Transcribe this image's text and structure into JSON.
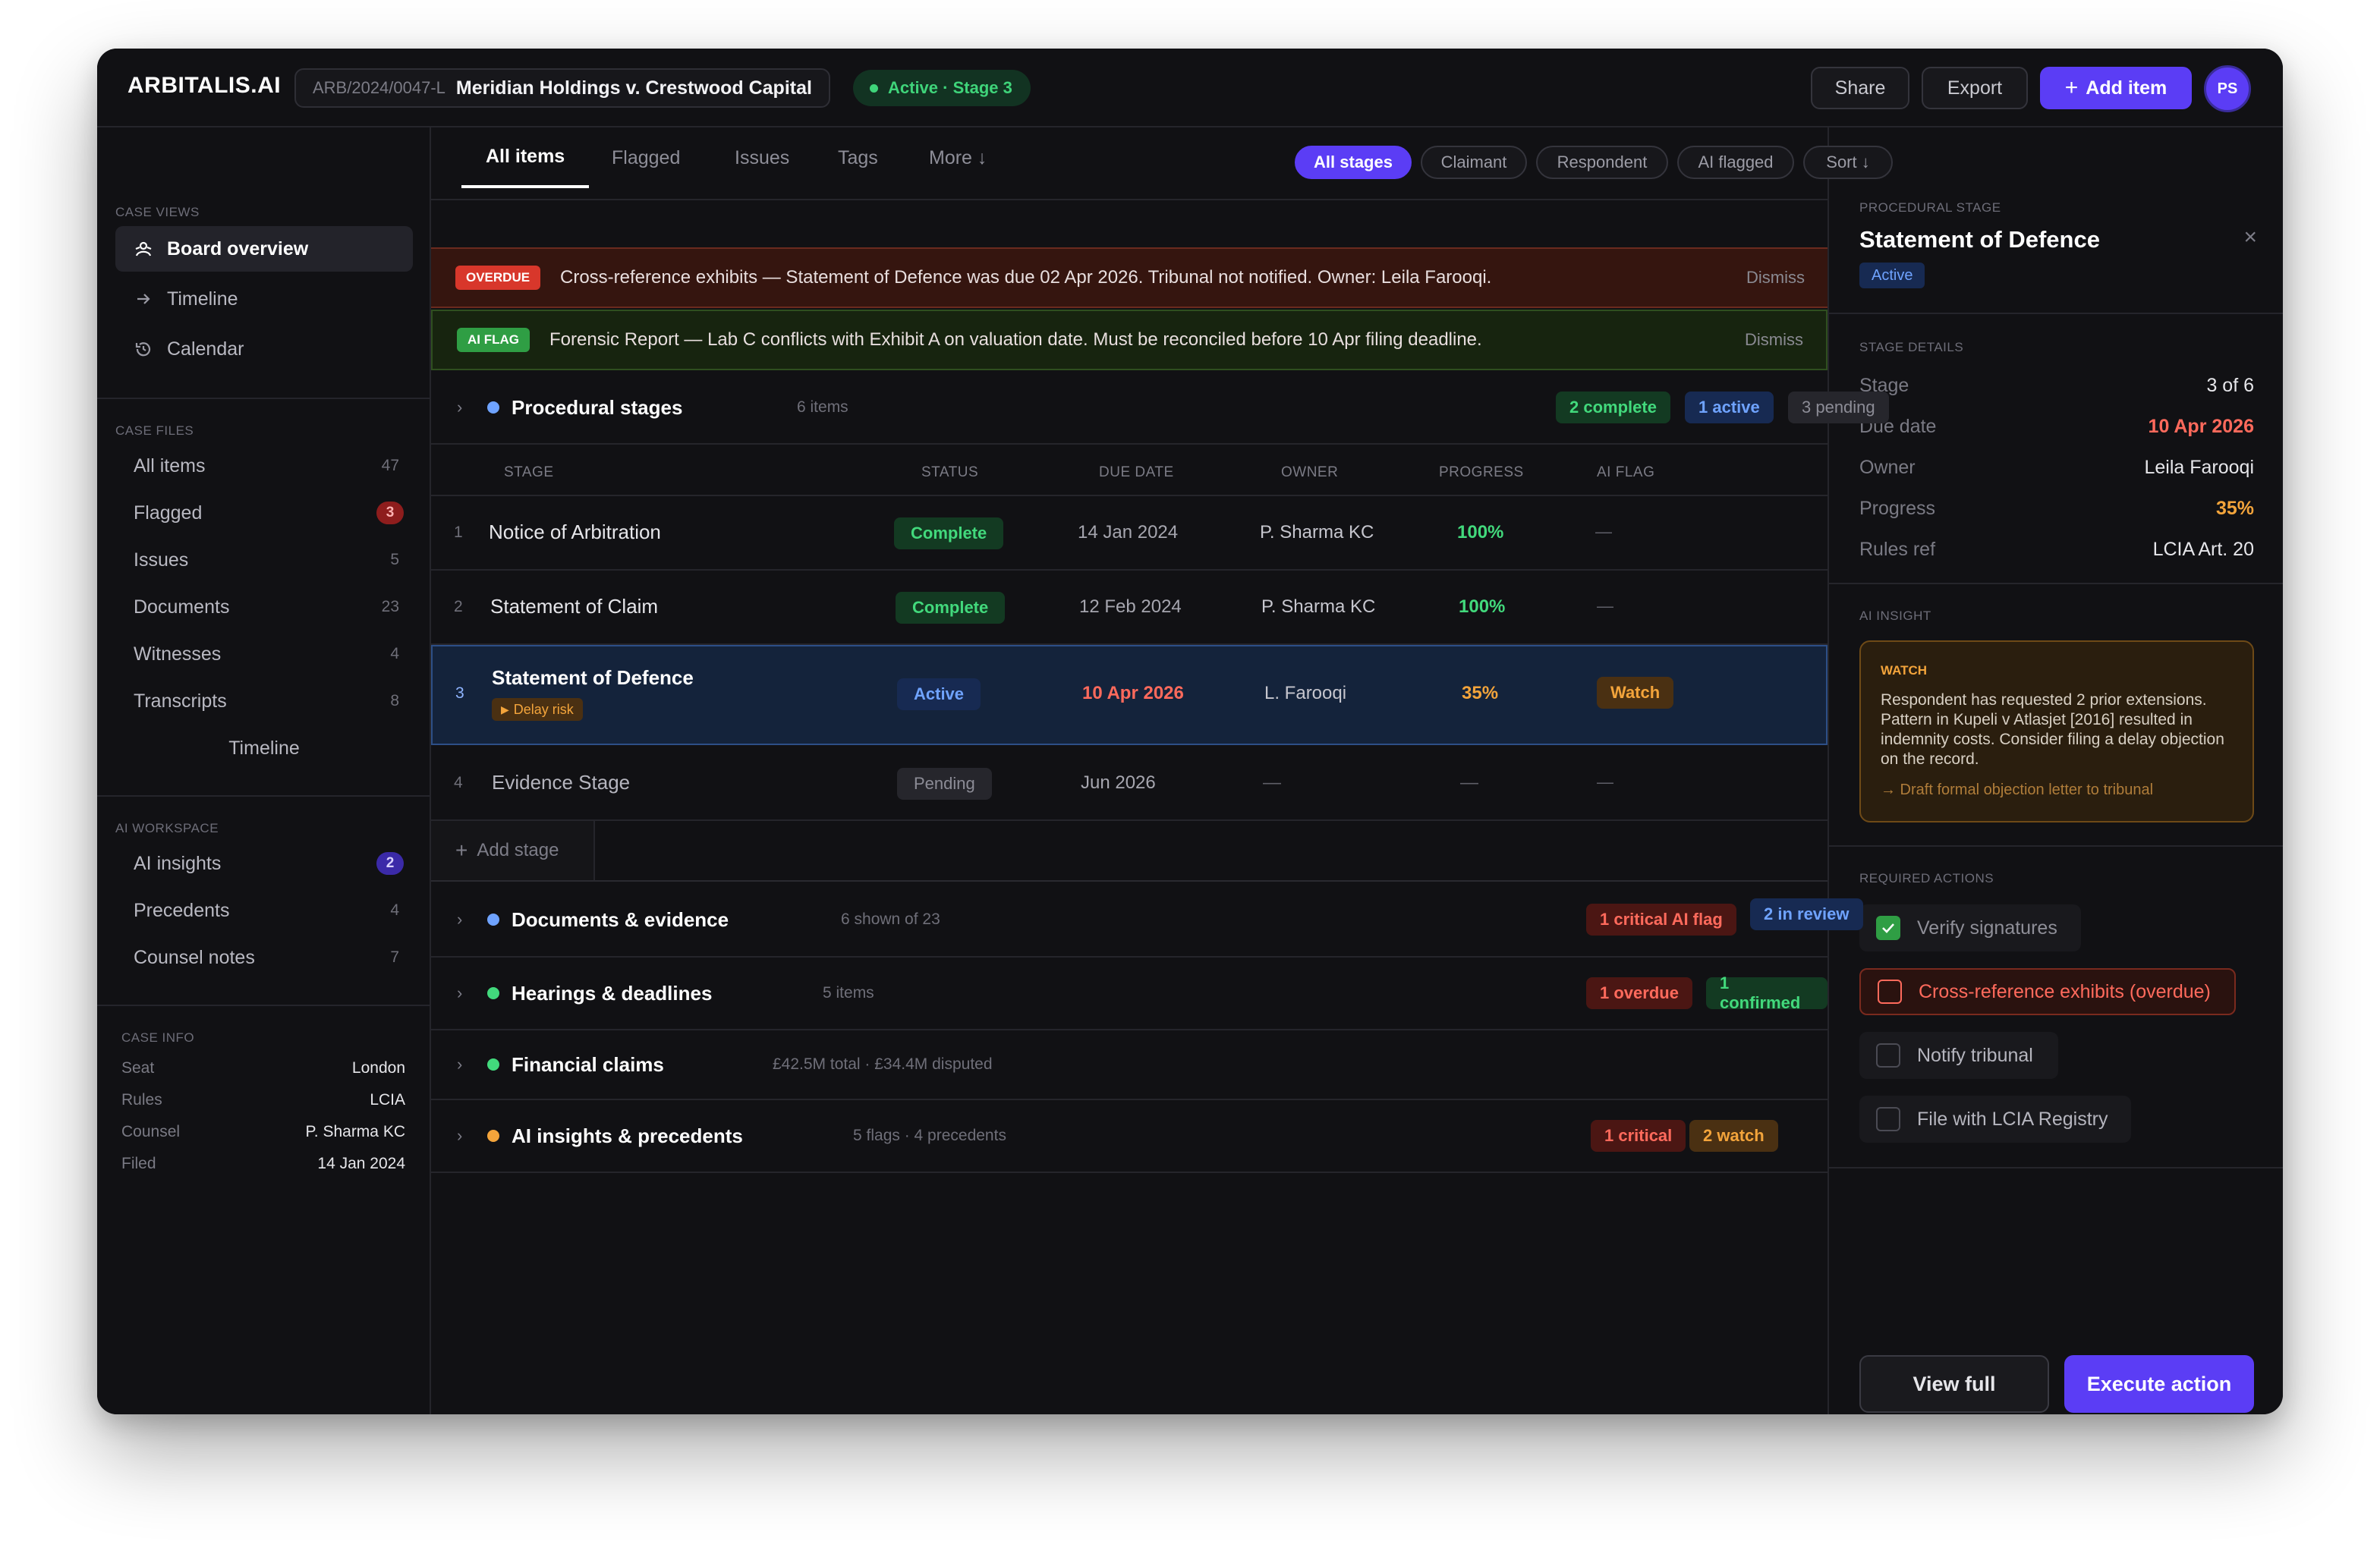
{
  "app": {
    "logo": "ARBITALIS.AI"
  },
  "case": {
    "id": "ARB/2024/0047-L",
    "name": "Meridian Holdings v. Crestwood Capital",
    "status": "Active · Stage 3"
  },
  "header": {
    "share": "Share",
    "export": "Export",
    "add_item": "Add item",
    "avatar": "PS"
  },
  "sidebar": {
    "case_views_label": "CASE VIEWS",
    "views": [
      {
        "label": "Board overview",
        "icon": "board-icon"
      },
      {
        "label": "Timeline",
        "icon": "arrow-right-icon"
      },
      {
        "label": "Calendar",
        "icon": "history-icon"
      }
    ],
    "case_files_label": "CASE FILES",
    "files": [
      {
        "label": "All items",
        "count": "47"
      },
      {
        "label": "Flagged",
        "count": "3"
      },
      {
        "label": "Issues",
        "count": "5"
      },
      {
        "label": "Documents",
        "count": "23"
      },
      {
        "label": "Witnesses",
        "count": "4"
      },
      {
        "label": "Transcripts",
        "count": "8"
      }
    ],
    "files_timeline": "Timeline",
    "ai_workspace_label": "AI WORKSPACE",
    "ai": [
      {
        "label": "AI insights",
        "count": "2"
      },
      {
        "label": "Precedents",
        "count": "4"
      },
      {
        "label": "Counsel notes",
        "count": "7"
      }
    ],
    "case_info_label": "CASE INFO",
    "info": [
      {
        "k": "Seat",
        "v": "London"
      },
      {
        "k": "Rules",
        "v": "LCIA"
      },
      {
        "k": "Counsel",
        "v": "P. Sharma KC"
      },
      {
        "k": "Filed",
        "v": "14 Jan 2024"
      }
    ]
  },
  "tabs": [
    "All items",
    "Flagged",
    "Issues",
    "Tags",
    "More ↓"
  ],
  "filters": [
    "All stages",
    "Claimant",
    "Respondent",
    "AI flagged",
    "Sort ↓"
  ],
  "alerts": [
    {
      "tag": "OVERDUE",
      "message": "Cross-reference exhibits — Statement of Defence was due 02 Apr 2026. Tribunal not notified. Owner: Leila Farooqi.",
      "dismiss": "Dismiss"
    },
    {
      "tag": "AI FLAG",
      "message": "Forensic Report — Lab C conflicts with Exhibit A on valuation date. Must be reconciled before 10 Apr filing deadline.",
      "dismiss": "Dismiss"
    }
  ],
  "procedural": {
    "name": "Procedural stages",
    "sub": "6 items",
    "pills": [
      "2 complete",
      "1 active",
      "3 pending"
    ],
    "columns": [
      "STAGE",
      "STATUS",
      "DUE DATE",
      "OWNER",
      "PROGRESS",
      "AI FLAG"
    ],
    "rows": [
      {
        "num": "1",
        "name": "Notice of Arbitration",
        "status": "Complete",
        "due": "14 Jan 2024",
        "owner": "P. Sharma KC",
        "progress": "100%",
        "flag": "—"
      },
      {
        "num": "2",
        "name": "Statement of Claim",
        "status": "Complete",
        "due": "12 Feb 2024",
        "owner": "P. Sharma KC",
        "progress": "100%",
        "flag": "—"
      },
      {
        "num": "3",
        "name": "Statement of Defence",
        "sub": "Delay risk",
        "status": "Active",
        "due": "10 Apr 2026",
        "owner": "L. Farooqi",
        "progress": "35%",
        "flag": "Watch"
      },
      {
        "num": "4",
        "name": "Evidence Stage",
        "status": "Pending",
        "due": "Jun 2026",
        "owner": "—",
        "progress": "—",
        "flag": "—"
      }
    ],
    "add_stage": "Add stage"
  },
  "groups": [
    {
      "name": "Documents & evidence",
      "sub": "6 shown of 23",
      "pills": [
        "1 critical AI flag",
        "2 in review"
      ]
    },
    {
      "name": "Hearings & deadlines",
      "sub": "5 items",
      "pills": [
        "1 overdue",
        "1 confirmed"
      ]
    },
    {
      "name": "Financial claims",
      "sub": "£42.5M total · £34.4M disputed",
      "pills": []
    },
    {
      "name": "AI insights & precedents",
      "sub": "5 flags · 4 precedents",
      "pills": [
        "1 critical",
        "2 watch"
      ]
    }
  ],
  "panel": {
    "label": "PROCEDURAL STAGE",
    "title": "Statement of Defence",
    "badge": "Active",
    "details_label": "STAGE DETAILS",
    "details": [
      {
        "k": "Stage",
        "v": "3 of 6"
      },
      {
        "k": "Due date",
        "v": "10 Apr 2026"
      },
      {
        "k": "Owner",
        "v": "Leila Farooqi"
      },
      {
        "k": "Progress",
        "v": "35%"
      },
      {
        "k": "Rules ref",
        "v": "LCIA Art. 20"
      }
    ],
    "insight_label": "AI INSIGHT",
    "insight": {
      "tag": "WATCH",
      "text": "Respondent has requested 2 prior extensions. Pattern in Kupeli v Atlasjet [2016] resulted in indemnity costs. Consider filing a delay objection on the record.",
      "link": "→ Draft formal objection letter to tribunal"
    },
    "actions_label": "REQUIRED ACTIONS",
    "actions": [
      {
        "label": "Verify signatures",
        "checked": true
      },
      {
        "label": "Cross-reference exhibits (overdue)",
        "checked": false
      },
      {
        "label": "Notify tribunal",
        "checked": false
      },
      {
        "label": "File with LCIA Registry",
        "checked": false
      }
    ],
    "view_full": "View full",
    "execute": "Execute action"
  },
  "colors": {
    "accent": "#5b3df5",
    "green": "#42d97c",
    "red": "#ff6a5c",
    "orange": "#f3a43b",
    "blue": "#6fa3ff"
  }
}
